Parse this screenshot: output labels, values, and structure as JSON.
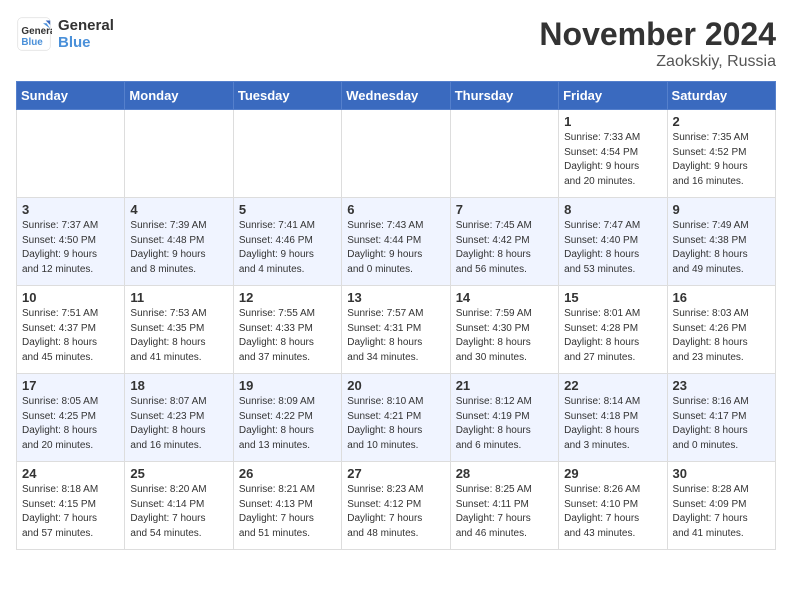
{
  "header": {
    "logo_line1": "General",
    "logo_line2": "Blue",
    "month_title": "November 2024",
    "location": "Zaokskiy, Russia"
  },
  "weekdays": [
    "Sunday",
    "Monday",
    "Tuesday",
    "Wednesday",
    "Thursday",
    "Friday",
    "Saturday"
  ],
  "weeks": [
    [
      {
        "day": "",
        "info": ""
      },
      {
        "day": "",
        "info": ""
      },
      {
        "day": "",
        "info": ""
      },
      {
        "day": "",
        "info": ""
      },
      {
        "day": "",
        "info": ""
      },
      {
        "day": "1",
        "info": "Sunrise: 7:33 AM\nSunset: 4:54 PM\nDaylight: 9 hours\nand 20 minutes."
      },
      {
        "day": "2",
        "info": "Sunrise: 7:35 AM\nSunset: 4:52 PM\nDaylight: 9 hours\nand 16 minutes."
      }
    ],
    [
      {
        "day": "3",
        "info": "Sunrise: 7:37 AM\nSunset: 4:50 PM\nDaylight: 9 hours\nand 12 minutes."
      },
      {
        "day": "4",
        "info": "Sunrise: 7:39 AM\nSunset: 4:48 PM\nDaylight: 9 hours\nand 8 minutes."
      },
      {
        "day": "5",
        "info": "Sunrise: 7:41 AM\nSunset: 4:46 PM\nDaylight: 9 hours\nand 4 minutes."
      },
      {
        "day": "6",
        "info": "Sunrise: 7:43 AM\nSunset: 4:44 PM\nDaylight: 9 hours\nand 0 minutes."
      },
      {
        "day": "7",
        "info": "Sunrise: 7:45 AM\nSunset: 4:42 PM\nDaylight: 8 hours\nand 56 minutes."
      },
      {
        "day": "8",
        "info": "Sunrise: 7:47 AM\nSunset: 4:40 PM\nDaylight: 8 hours\nand 53 minutes."
      },
      {
        "day": "9",
        "info": "Sunrise: 7:49 AM\nSunset: 4:38 PM\nDaylight: 8 hours\nand 49 minutes."
      }
    ],
    [
      {
        "day": "10",
        "info": "Sunrise: 7:51 AM\nSunset: 4:37 PM\nDaylight: 8 hours\nand 45 minutes."
      },
      {
        "day": "11",
        "info": "Sunrise: 7:53 AM\nSunset: 4:35 PM\nDaylight: 8 hours\nand 41 minutes."
      },
      {
        "day": "12",
        "info": "Sunrise: 7:55 AM\nSunset: 4:33 PM\nDaylight: 8 hours\nand 37 minutes."
      },
      {
        "day": "13",
        "info": "Sunrise: 7:57 AM\nSunset: 4:31 PM\nDaylight: 8 hours\nand 34 minutes."
      },
      {
        "day": "14",
        "info": "Sunrise: 7:59 AM\nSunset: 4:30 PM\nDaylight: 8 hours\nand 30 minutes."
      },
      {
        "day": "15",
        "info": "Sunrise: 8:01 AM\nSunset: 4:28 PM\nDaylight: 8 hours\nand 27 minutes."
      },
      {
        "day": "16",
        "info": "Sunrise: 8:03 AM\nSunset: 4:26 PM\nDaylight: 8 hours\nand 23 minutes."
      }
    ],
    [
      {
        "day": "17",
        "info": "Sunrise: 8:05 AM\nSunset: 4:25 PM\nDaylight: 8 hours\nand 20 minutes."
      },
      {
        "day": "18",
        "info": "Sunrise: 8:07 AM\nSunset: 4:23 PM\nDaylight: 8 hours\nand 16 minutes."
      },
      {
        "day": "19",
        "info": "Sunrise: 8:09 AM\nSunset: 4:22 PM\nDaylight: 8 hours\nand 13 minutes."
      },
      {
        "day": "20",
        "info": "Sunrise: 8:10 AM\nSunset: 4:21 PM\nDaylight: 8 hours\nand 10 minutes."
      },
      {
        "day": "21",
        "info": "Sunrise: 8:12 AM\nSunset: 4:19 PM\nDaylight: 8 hours\nand 6 minutes."
      },
      {
        "day": "22",
        "info": "Sunrise: 8:14 AM\nSunset: 4:18 PM\nDaylight: 8 hours\nand 3 minutes."
      },
      {
        "day": "23",
        "info": "Sunrise: 8:16 AM\nSunset: 4:17 PM\nDaylight: 8 hours\nand 0 minutes."
      }
    ],
    [
      {
        "day": "24",
        "info": "Sunrise: 8:18 AM\nSunset: 4:15 PM\nDaylight: 7 hours\nand 57 minutes."
      },
      {
        "day": "25",
        "info": "Sunrise: 8:20 AM\nSunset: 4:14 PM\nDaylight: 7 hours\nand 54 minutes."
      },
      {
        "day": "26",
        "info": "Sunrise: 8:21 AM\nSunset: 4:13 PM\nDaylight: 7 hours\nand 51 minutes."
      },
      {
        "day": "27",
        "info": "Sunrise: 8:23 AM\nSunset: 4:12 PM\nDaylight: 7 hours\nand 48 minutes."
      },
      {
        "day": "28",
        "info": "Sunrise: 8:25 AM\nSunset: 4:11 PM\nDaylight: 7 hours\nand 46 minutes."
      },
      {
        "day": "29",
        "info": "Sunrise: 8:26 AM\nSunset: 4:10 PM\nDaylight: 7 hours\nand 43 minutes."
      },
      {
        "day": "30",
        "info": "Sunrise: 8:28 AM\nSunset: 4:09 PM\nDaylight: 7 hours\nand 41 minutes."
      }
    ]
  ]
}
